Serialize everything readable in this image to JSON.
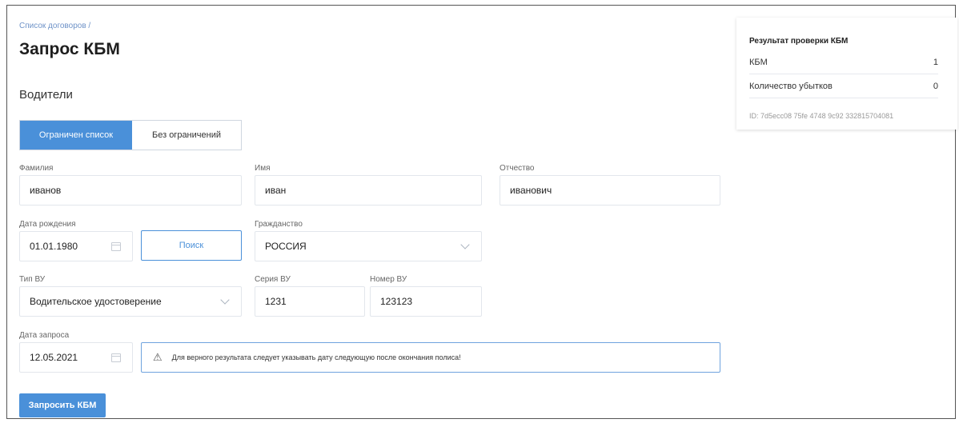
{
  "breadcrumb": "Список договоров /",
  "page_title": "Запрос КБМ",
  "section_title": "Водители",
  "tabs": [
    {
      "label": "Ограничен список"
    },
    {
      "label": "Без ограничений"
    }
  ],
  "form": {
    "last_name": {
      "label": "Фамилия",
      "value": "иванов"
    },
    "first_name": {
      "label": "Имя",
      "value": "иван"
    },
    "patronymic": {
      "label": "Отчество",
      "value": "иванович"
    },
    "birth_date": {
      "label": "Дата рождения",
      "value": "01.01.1980"
    },
    "search_label": "Поиск",
    "citizenship": {
      "label": "Гражданство",
      "value": "РОССИЯ"
    },
    "license_type": {
      "label": "Тип ВУ",
      "value": "Водительское удостоверение"
    },
    "license_series": {
      "label": "Серия ВУ",
      "value": "1231"
    },
    "license_number": {
      "label": "Номер ВУ",
      "value": "123123"
    },
    "request_date": {
      "label": "Дата запроса",
      "value": "12.05.2021"
    },
    "alert_text": "Для верного результата следует указывать дату следующую после окончания полиса!",
    "submit_label": "Запросить КБМ"
  },
  "result": {
    "title": "Результат проверки КБМ",
    "rows": [
      {
        "label": "КБМ",
        "value": "1"
      },
      {
        "label": "Количество убытков",
        "value": "0"
      }
    ],
    "id_text": "ID: 7d5ecc08 75fe 4748 9c92 332815704081"
  },
  "colors": {
    "accent": "#4a90d9",
    "link": "#6f93c8"
  }
}
